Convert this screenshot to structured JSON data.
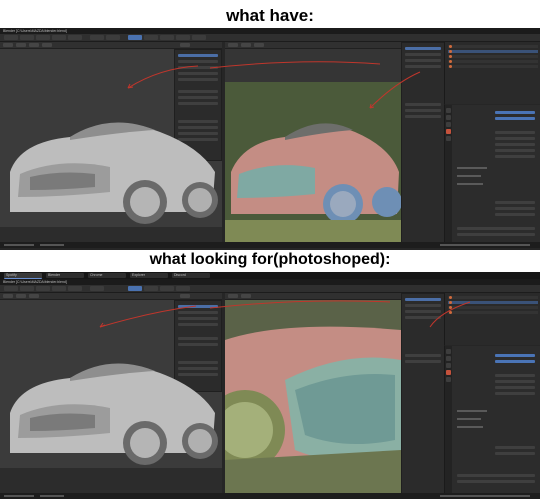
{
  "headings": {
    "top": "what have:",
    "bottom": "what looking for(photoshoped):"
  },
  "screenshot_1": {
    "window_title": "Blender [C:\\Users\\MAZDA\\blender.blend]",
    "taskbar_items": []
  },
  "screenshot_2": {
    "window_title": "Blender [C:\\Users\\MAZDA\\blender.blend]",
    "taskbar_items": [
      "Spotify",
      "Blender",
      "Chrome",
      "Explorer",
      "Discord"
    ]
  },
  "colors": {
    "background": "#ffffff",
    "ui_dark": "#262626",
    "viewport_grey": "#3b3b3b",
    "accent_blue": "#4a74b6",
    "annotation_red": "#c0362c",
    "clay_body": "#b9b9b9",
    "tinted_body": "#c48d84",
    "tinted_grille": "#7fa9a3",
    "tinted_wheel": "#6e8fb5",
    "ground_green": "#7f8a55"
  },
  "icons": [
    "camera-icon",
    "scene-icon",
    "object-icon",
    "material-icon",
    "world-icon"
  ]
}
